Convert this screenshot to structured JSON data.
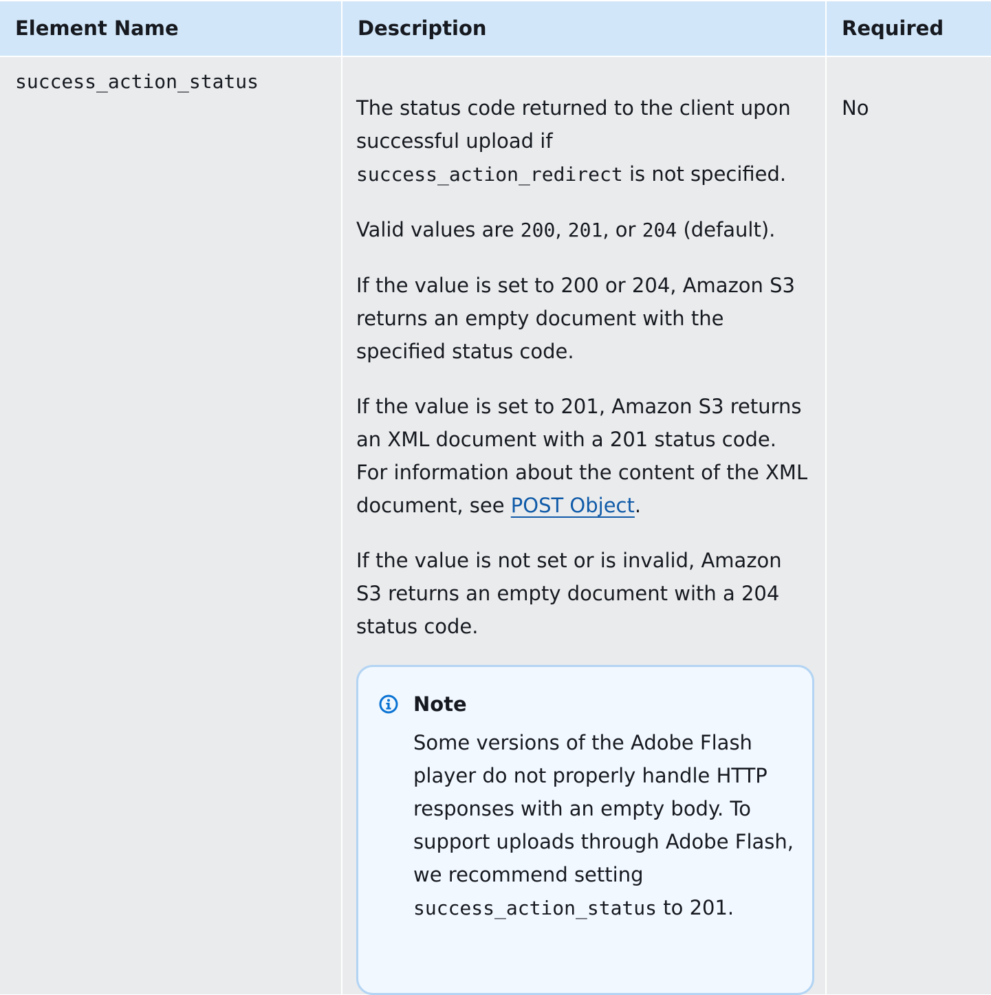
{
  "table": {
    "headers": [
      "Element Name",
      "Description",
      "Required"
    ],
    "row": {
      "element_name": "success_action_status",
      "required": "No",
      "desc": {
        "p1_text_a": "The status code returned to the client upon successful upload  if ",
        "p1_code": "success_action_redirect",
        "p1_text_b": "  is not specified.",
        "p2_text_a": "Valid values are ",
        "p2_code_1": "200",
        "p2_sep_1": ", ",
        "p2_code_2": "201",
        "p2_sep_2": ", or  ",
        "p2_code_3": "204",
        "p2_text_b": " (default).",
        "p3": "If the value is set to 200 or 204, Amazon S3 returns an empty  document with the specified status code.",
        "p4_text_a": "If the value is set to 201, Amazon S3 returns an XML document with  a 201 status code. For information about the content of the XML  document, see ",
        "p4_link": "POST Object",
        "p4_text_b": ".",
        "p5": "If the value is not set or is invalid, Amazon S3 returns an empty  document with a 204 status code."
      },
      "note": {
        "title": "Note",
        "text_a": "Some versions of the Adobe Flash player do not properly   handle HTTP responses with an empty body. To support uploads  through Adobe Flash, we recommend setting ",
        "code": "success_action_status",
        "text_b": "  to 201."
      }
    }
  },
  "colors": {
    "header_bg": "#d1e6f9",
    "cell_bg": "#e9ebed",
    "link": "#0f5aa8",
    "note_border": "#b3d4f3",
    "note_bg": "#f1f8ff",
    "info_icon": "#0972d3"
  }
}
